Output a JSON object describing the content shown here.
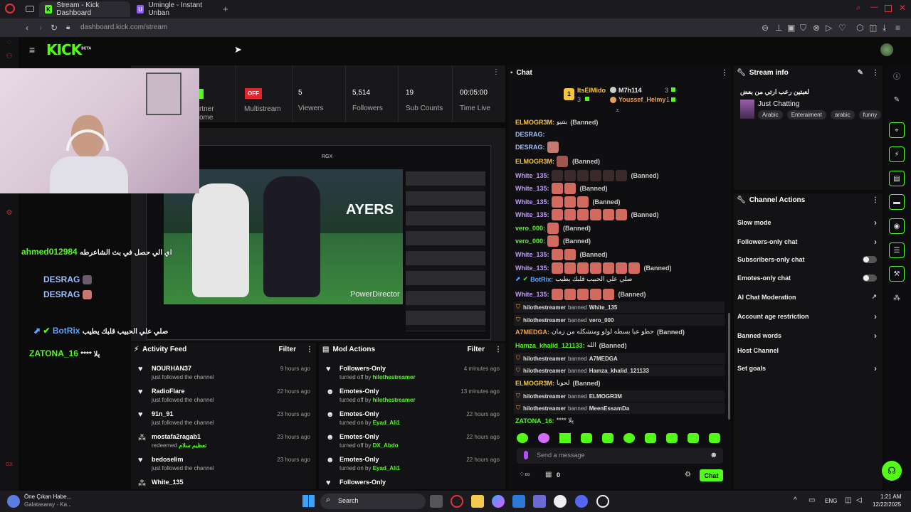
{
  "browser": {
    "tabs": [
      {
        "label": "Stream - Kick Dashboard"
      },
      {
        "label": "Umingle - Instant Unban"
      }
    ],
    "url": "dashboard.kick.com/stream"
  },
  "header": {
    "logo": "KICK",
    "logo_tag": "BETA"
  },
  "stats": {
    "partner_badge": "",
    "partner_label_1": "rtner",
    "partner_label_2": "ome",
    "multistream_badge": "OFF",
    "multistream_label": "Multistream",
    "viewers_value": "5",
    "viewers_label": "Viewers",
    "followers_value": "5,514",
    "followers_label": "Followers",
    "subs_value": "19",
    "subs_label": "Sub Counts",
    "time_value": "00:05:00",
    "time_label": "Time Live"
  },
  "preview": {
    "inner_badge": "RGX",
    "video_text": "AYERS",
    "watermark": "PowerDirector"
  },
  "overlay": {
    "line1_user": "ahmed012984",
    "line1_msg": "اي الي حصل في بث الشاعرطه",
    "line2_user": "DESRAG",
    "line3_user": "DESRAG",
    "line4_user": "BotRix",
    "line4_msg": "صلي علي الحبيب قلبك يطيب",
    "line5_user": "ZATONA_16",
    "line5_msg": "**** يلا"
  },
  "chat": {
    "title": "Chat",
    "top1_rank": "1",
    "top1_user": "ItsElMido",
    "top1_count": "3",
    "top2_user": "M7h114",
    "top2_count": "3",
    "top3_user": "Youssef_Helmy",
    "top3_count": "1",
    "messages": [
      {
        "user": "ELMOGR3M:",
        "text": "بتتيو",
        "banned": "(Banned)"
      },
      {
        "user": "DESRAG:",
        "text": "",
        "banned": ""
      },
      {
        "user": "DESRAG:",
        "text": "",
        "banned": ""
      },
      {
        "user": "ELMOGR3M:",
        "text": "",
        "banned": "(Banned)"
      },
      {
        "user": "White_135:",
        "text": "",
        "banned": "(Banned)"
      },
      {
        "user": "White_135:",
        "text": "",
        "banned": "(Banned)"
      },
      {
        "user": "White_135:",
        "text": "",
        "banned": "(Banned)"
      },
      {
        "user": "White_135:",
        "text": "",
        "banned": "(Banned)"
      },
      {
        "user": "vero_000:",
        "text": "",
        "banned": "(Banned)"
      },
      {
        "user": "vero_000:",
        "text": "",
        "banned": "(Banned)"
      },
      {
        "user": "White_135:",
        "text": "",
        "banned": "(Banned)"
      },
      {
        "user": "White_135:",
        "text": "",
        "banned": "(Banned)"
      },
      {
        "user": "BotRix:",
        "text": "صلي علي الحبيب قلبك يطيب",
        "banned": ""
      },
      {
        "user": "White_135:",
        "text": "",
        "banned": "(Banned)"
      }
    ],
    "mod1": {
      "mod": "hilothestreamer",
      "action": "banned",
      "target": "White_135"
    },
    "mod2": {
      "mod": "hilothestreamer",
      "action": "banned",
      "target": "vero_000"
    },
    "a7_user": "A7MEDGA:",
    "a7_text": "حطو عبا بسطه لولو ومنشكله من زمان",
    "a7_banned": "(Banned)",
    "hk_user": "Hamza_khalid_121133:",
    "hk_text": "الله",
    "hk_banned": "(Banned)",
    "mod3": {
      "mod": "hilothestreamer",
      "action": "banned",
      "target": "A7MEDGA"
    },
    "mod4": {
      "mod": "hilothestreamer",
      "action": "banned",
      "target": "Hamza_khalid_121133"
    },
    "el_user": "ELMOGR3M:",
    "el_text": "لحوبا",
    "el_banned": "(Banned)",
    "mod5": {
      "mod": "hilothestreamer",
      "action": "banned",
      "target": "ELMOGR3M"
    },
    "mod6": {
      "mod": "hilothestreamer",
      "action": "banned",
      "target": "MeenEssamDa"
    },
    "zt_user": "ZATONA_16:",
    "zt_text": "**** يلا",
    "input_placeholder": "Send a message",
    "points": "0",
    "send_label": "Chat"
  },
  "info": {
    "title": "Stream info",
    "stream_title": "لعبتين رعب ارتي من بعض",
    "category": "Just Chatting",
    "tags": [
      "Arabic",
      "Enteraiment",
      "arabic",
      "funny"
    ]
  },
  "actions": {
    "title": "Channel Actions",
    "items": [
      "Slow mode",
      "Followers-only chat",
      "Subscribers-only chat",
      "Emotes-only chat",
      "AI Chat Moderation",
      "Account age restriction",
      "Banned words",
      "Host Channel",
      "Set goals"
    ]
  },
  "activity": {
    "title": "Activity Feed",
    "filter": "Filter",
    "items": [
      {
        "name": "NOURHAN37",
        "sub": "just followed the channel",
        "time": "9 hours ago"
      },
      {
        "name": "RadioFlare",
        "sub": "just followed the channel",
        "time": "22 hours ago"
      },
      {
        "name": "91n_91",
        "sub": "just followed the channel",
        "time": "23 hours ago"
      },
      {
        "name": "mostafa2ragab1",
        "sub": "redeemed",
        "sub_green": "تعظيم سلام",
        "time": "23 hours ago"
      },
      {
        "name": "bedoselim",
        "sub": "just followed the channel",
        "time": "23 hours ago"
      },
      {
        "name": "White_135",
        "sub": "",
        "time": ""
      }
    ]
  },
  "modactions": {
    "title": "Mod Actions",
    "filter": "Filter",
    "items": [
      {
        "name": "Followers-Only",
        "sub": "turned off by",
        "by": "hilothestreamer",
        "time": "4 minutes ago"
      },
      {
        "name": "Emotes-Only",
        "sub": "turned off by",
        "by": "hilothestreamer",
        "time": "13 minutes ago"
      },
      {
        "name": "Emotes-Only",
        "sub": "turned on by",
        "by": "Eyad_Ali1",
        "time": "22 hours ago"
      },
      {
        "name": "Emotes-Only",
        "sub": "turned off by",
        "by": "DX_Abdo",
        "time": "22 hours ago"
      },
      {
        "name": "Emotes-Only",
        "sub": "turned on by",
        "by": "Eyad_Ali1",
        "time": "22 hours ago"
      },
      {
        "name": "Followers-Only",
        "sub": "",
        "by": "",
        "time": ""
      }
    ]
  },
  "taskbar": {
    "news_title": "Öne Çıkan Habe...",
    "news_sub": "Galatasaray - Ka...",
    "search": "Search",
    "lang": "ENG",
    "time": "1:21 AM",
    "date": "12/22/2025"
  },
  "colors": {
    "brand": "#53fc18",
    "accent_purple": "#c49bff",
    "accent_blue": "#5aa5ff",
    "accent_orange": "#f2a44a"
  }
}
